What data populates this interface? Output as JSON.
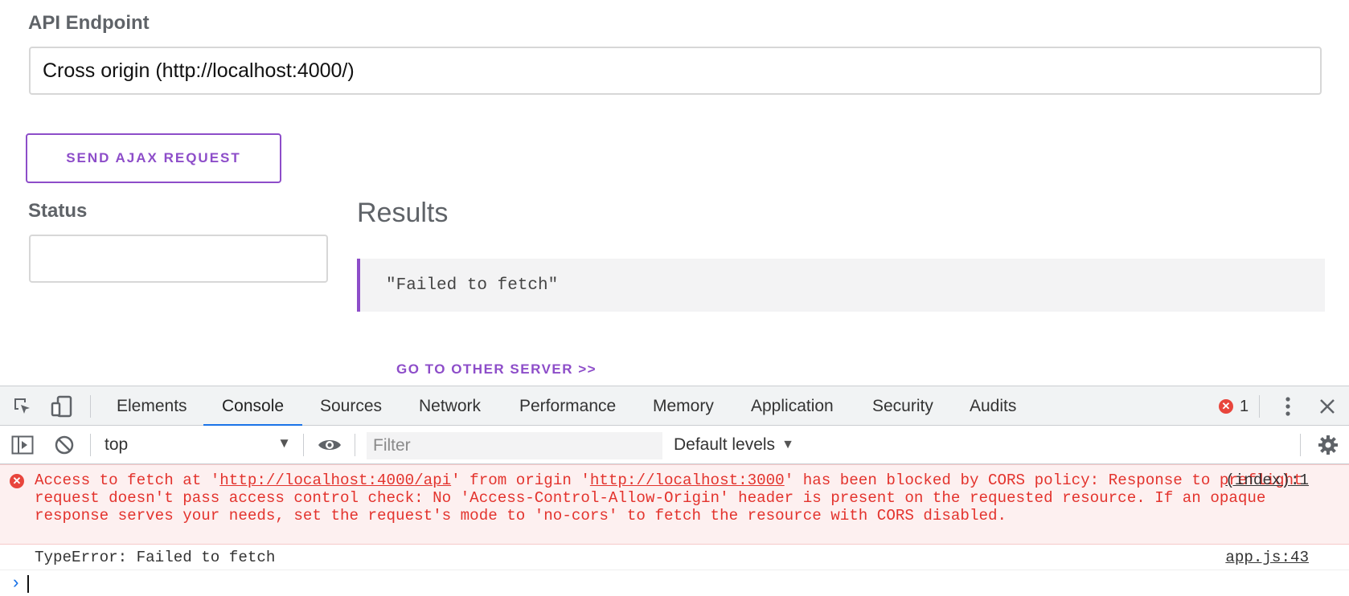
{
  "app": {
    "endpoint_label": "API Endpoint",
    "endpoint_value": "Cross origin (http://localhost:4000/)",
    "send_button": "SEND AJAX REQUEST",
    "status_label": "Status",
    "status_value": "",
    "results_title": "Results",
    "results_value": "\"Failed to fetch\"",
    "other_server_link": "GO TO OTHER SERVER >>",
    "accent_color": "#8d4dc9"
  },
  "devtools": {
    "tabs": [
      {
        "label": "Elements",
        "active": false
      },
      {
        "label": "Console",
        "active": true
      },
      {
        "label": "Sources",
        "active": false
      },
      {
        "label": "Network",
        "active": false
      },
      {
        "label": "Performance",
        "active": false
      },
      {
        "label": "Memory",
        "active": false
      },
      {
        "label": "Application",
        "active": false
      },
      {
        "label": "Security",
        "active": false
      },
      {
        "label": "Audits",
        "active": false
      }
    ],
    "error_count": "1",
    "icons": {
      "inspect": "inspect-element-icon",
      "device": "device-toolbar-icon",
      "more": "more-vertical-icon",
      "close": "close-icon",
      "sidebar": "sidebar-toggle-icon",
      "clear": "clear-console-icon",
      "eye": "eye-icon",
      "settings": "gear-icon"
    },
    "toolbar": {
      "context": "top",
      "filter_placeholder": "Filter",
      "levels": "Default levels"
    },
    "messages": {
      "error": {
        "text_1": "Access to fetch at '",
        "url_1": "http://localhost:4000/api",
        "text_2": "' from origin '",
        "url_2": "http://localhost:3000",
        "text_3": "' has been blocked by CORS policy: Response to preflight request doesn't pass access control check: No 'Access-Control-Allow-Origin' header is present on the requested resource. If an opaque response serves your needs, set the request's mode to 'no-cors' to fetch the resource with CORS disabled.",
        "source": "(index):1",
        "color": "#e3332d"
      },
      "log": {
        "text": "TypeError: Failed to fetch",
        "source": "app.js:43"
      }
    },
    "prompt_symbol": "›"
  }
}
